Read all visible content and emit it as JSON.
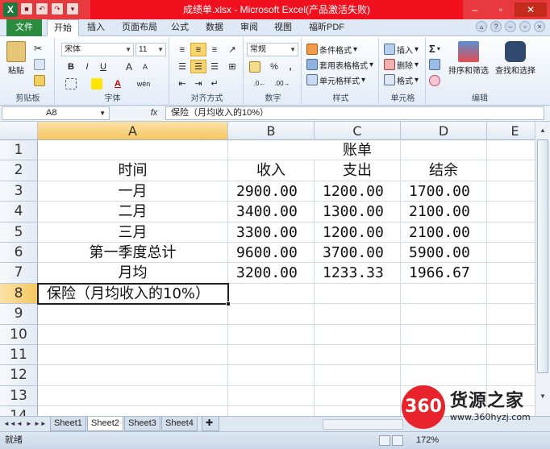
{
  "window": {
    "title": "成绩单.xlsx - Microsoft Excel(产品激活失败)",
    "app_icon": "X",
    "min_glyph": "–",
    "restore_glyph": "▫",
    "close_glyph": "✕"
  },
  "ribbon_tabs": [
    "文件",
    "开始",
    "插入",
    "页面布局",
    "公式",
    "数据",
    "审阅",
    "视图",
    "福昕PDF"
  ],
  "ribbon": {
    "clipboard": {
      "label": "剪贴板",
      "paste": "粘贴"
    },
    "font": {
      "label": "字体",
      "family": "宋体",
      "size": "11",
      "bold": "B",
      "italic": "I",
      "underline": "U",
      "grow": "A",
      "shrink": "A",
      "wen": "wén"
    },
    "alignment": {
      "label": "对齐方式"
    },
    "number": {
      "label": "数字",
      "format": "常规",
      "percent": "%",
      "comma": ","
    },
    "styles": {
      "label": "样式",
      "conditional": "条件格式",
      "table": "套用表格格式",
      "cell": "单元格样式"
    },
    "cells": {
      "label": "单元格",
      "insert": "插入",
      "delete": "删除",
      "format": "格式"
    },
    "editing": {
      "label": "编辑",
      "sigma": "Σ",
      "sort": "排序和筛选",
      "find": "查找和选择"
    }
  },
  "formula_bar": {
    "name_box": "A8",
    "fx": "fx",
    "content": "保险（月均收入的10%）"
  },
  "columns": [
    "A",
    "B",
    "C",
    "D",
    "E"
  ],
  "rows": [
    {
      "num": "1",
      "cells": [
        "",
        "账单",
        "",
        ""
      ]
    },
    {
      "num": "2",
      "cells": [
        "时间",
        "收入",
        "支出",
        "结余"
      ]
    },
    {
      "num": "3",
      "cells": [
        "一月",
        "2900.00",
        "1200.00",
        "1700.00"
      ]
    },
    {
      "num": "4",
      "cells": [
        "二月",
        "3400.00",
        "1300.00",
        "2100.00"
      ]
    },
    {
      "num": "5",
      "cells": [
        "三月",
        "3300.00",
        "1200.00",
        "2100.00"
      ]
    },
    {
      "num": "6",
      "cells": [
        "第一季度总计",
        "9600.00",
        "3700.00",
        "5900.00"
      ]
    },
    {
      "num": "7",
      "cells": [
        "月均",
        "3200.00",
        "1233.33",
        "1966.67"
      ]
    },
    {
      "num": "8",
      "cells": [
        "保险（月均收入的10%）",
        "",
        "",
        ""
      ]
    },
    {
      "num": "9",
      "cells": [
        "",
        "",
        "",
        ""
      ]
    },
    {
      "num": "10",
      "cells": [
        "",
        "",
        "",
        ""
      ]
    },
    {
      "num": "11",
      "cells": [
        "",
        "",
        "",
        ""
      ]
    },
    {
      "num": "12",
      "cells": [
        "",
        "",
        "",
        ""
      ]
    },
    {
      "num": "13",
      "cells": [
        "",
        "",
        "",
        ""
      ]
    },
    {
      "num": "14",
      "cells": [
        "",
        "",
        "",
        ""
      ]
    }
  ],
  "selected_cell": "A8",
  "sheet_nav": [
    "◄◄",
    "◄",
    "►",
    "►►"
  ],
  "sheets": [
    "Sheet1",
    "Sheet2",
    "Sheet3",
    "Sheet4"
  ],
  "active_sheet": "Sheet2",
  "status": {
    "ready": "就绪",
    "zoom": "172%"
  },
  "watermark": {
    "logo": "360",
    "brand": "货源之家",
    "url": "www.360hyzj.com"
  },
  "colors": {
    "title_bar": "#f0101e",
    "file_tab": "#2a8b3f",
    "selection_header": "#f5c75f",
    "watermark_red": "#e8232b"
  }
}
